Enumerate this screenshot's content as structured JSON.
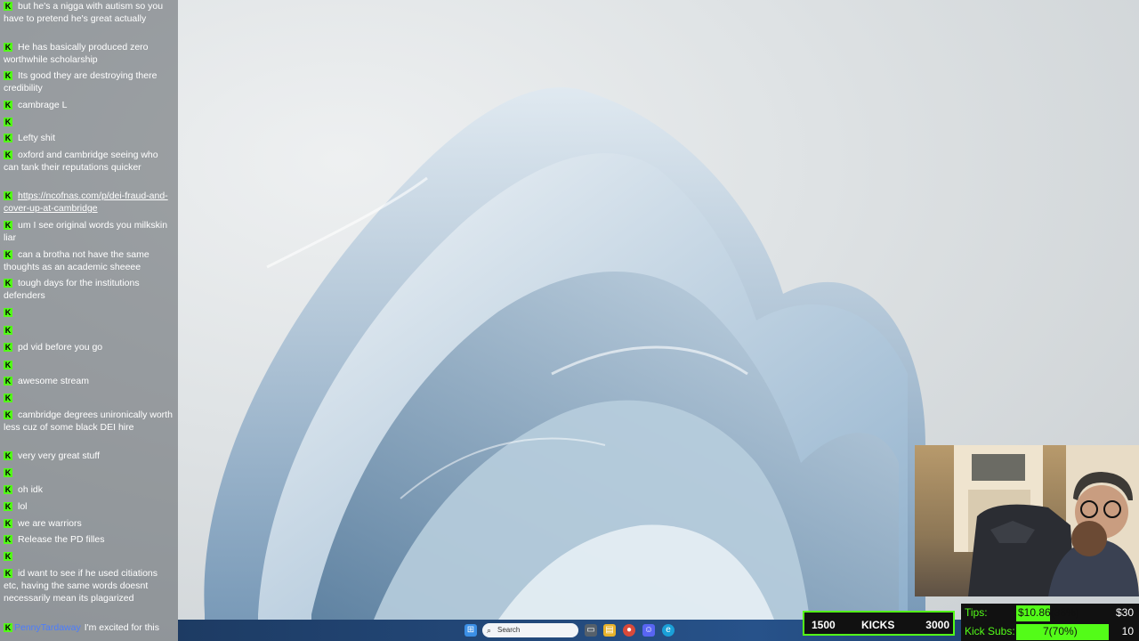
{
  "chat": {
    "messages": [
      {
        "user": "",
        "text": "but he's a nigga with autism so you have to pretend he's great actually",
        "link": false
      },
      {
        "user": "",
        "text": "He has basically produced zero worthwhile scholarship",
        "link": false
      },
      {
        "user": "",
        "text": "Its good they are destroying there credibility",
        "link": false
      },
      {
        "user": "",
        "text": "cambrage L",
        "link": false
      },
      {
        "user": "",
        "text": "",
        "link": false
      },
      {
        "user": "",
        "text": "Lefty shit",
        "link": false
      },
      {
        "user": "",
        "text": "oxford and cambridge seeing who can tank their reputations quicker",
        "link": false
      },
      {
        "user": "",
        "text": "https://ncofnas.com/p/dei-fraud-and-cover-up-at-cambridge",
        "link": true
      },
      {
        "user": "",
        "text": "um I see original words you milkskin liar",
        "link": false
      },
      {
        "user": "",
        "text": "can a brotha not have the same thoughts as an academic sheeee",
        "link": false
      },
      {
        "user": "",
        "text": "tough days for the institutions defenders",
        "link": false
      },
      {
        "user": "",
        "text": "",
        "link": false
      },
      {
        "user": "",
        "text": "",
        "link": false
      },
      {
        "user": "",
        "text": "pd vid before you go",
        "link": false
      },
      {
        "user": "",
        "text": "",
        "link": false
      },
      {
        "user": "",
        "text": "awesome stream",
        "link": false
      },
      {
        "user": "",
        "text": "",
        "link": false
      },
      {
        "user": "",
        "text": "cambridge degrees unironically worth less cuz of some black DEI hire",
        "link": false
      },
      {
        "user": "",
        "text": "very very great stuff",
        "link": false
      },
      {
        "user": "",
        "text": "",
        "link": false
      },
      {
        "user": "",
        "text": "oh idk",
        "link": false
      },
      {
        "user": "",
        "text": "lol",
        "link": false
      },
      {
        "user": "",
        "text": "we are warriors",
        "link": false
      },
      {
        "user": "",
        "text": "Release the PD filles",
        "link": false
      },
      {
        "user": "",
        "text": "",
        "link": false
      },
      {
        "user": "",
        "text": "id want to see if he used citiations etc, having the same words doesnt necessarily mean its plagarized",
        "link": false
      },
      {
        "user": "PennyTardaway",
        "text": "I'm excited for this",
        "link": false
      }
    ]
  },
  "taskbar": {
    "search_placeholder": "Search",
    "search_icon": "search-icon",
    "apps": [
      "windows-start-icon",
      "task-view-icon",
      "file-explorer-icon",
      "chrome-icon",
      "discord-icon",
      "edge-icon"
    ]
  },
  "overlay": {
    "kicks": {
      "start": "1500",
      "label": "KICKS",
      "goal": "3000"
    },
    "tips": {
      "label": "Tips:",
      "value": "$10.86(36%)",
      "goal": "$30",
      "progress": 0.36
    },
    "subs": {
      "label": "Kick Subs:",
      "value": "7(70%)",
      "goal": "10",
      "progress": 0.7
    }
  },
  "colors": {
    "kick_green": "#53fc18",
    "username_blue": "#4a7cff",
    "taskbar": "#27528a"
  }
}
